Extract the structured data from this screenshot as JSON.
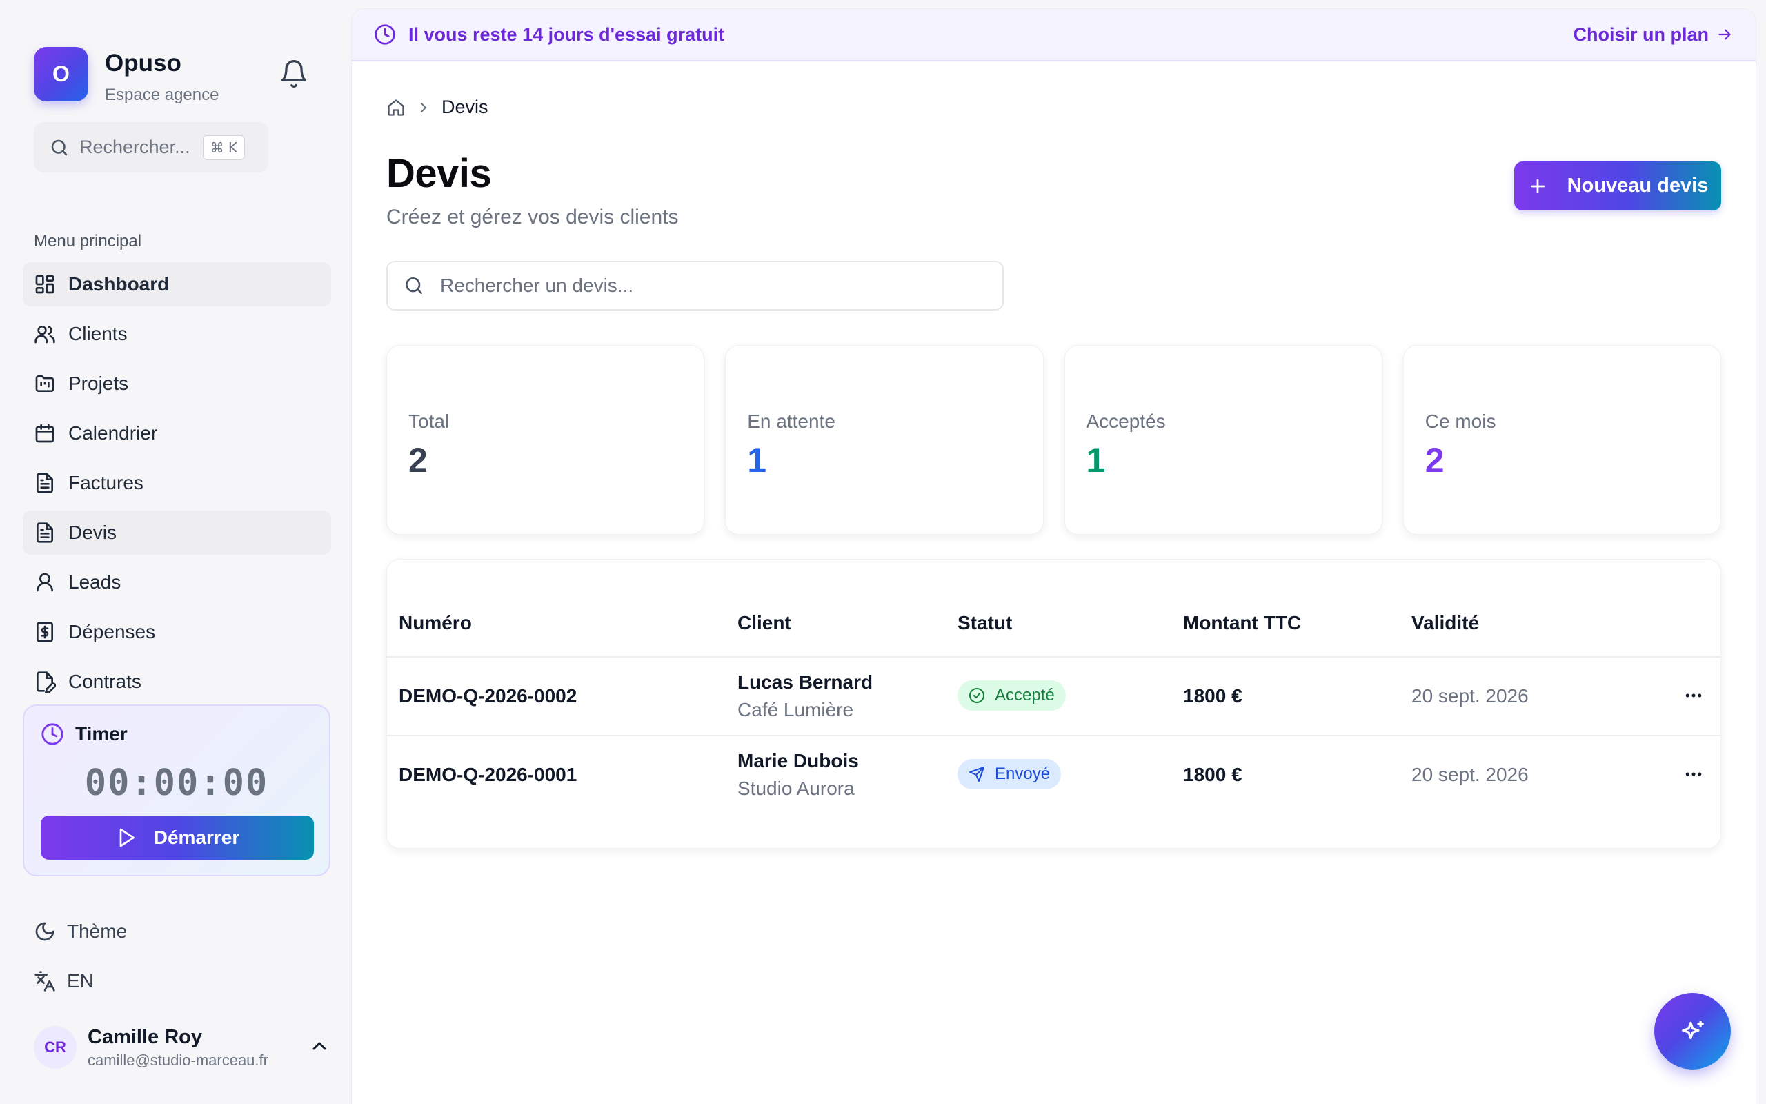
{
  "brand": {
    "logo_letter": "O",
    "name": "Opuso",
    "subtitle": "Espace agence"
  },
  "sidebar": {
    "search": {
      "placeholder": "Rechercher...",
      "shortcut": "⌘ K"
    },
    "menu_label": "Menu principal",
    "items": [
      {
        "label": "Dashboard",
        "icon": "dashboard-icon",
        "active": true
      },
      {
        "label": "Clients",
        "icon": "users-icon"
      },
      {
        "label": "Projets",
        "icon": "folder-kanban-icon"
      },
      {
        "label": "Calendrier",
        "icon": "calendar-icon"
      },
      {
        "label": "Factures",
        "icon": "file-text-icon"
      },
      {
        "label": "Devis",
        "icon": "file-text-icon",
        "active": true
      },
      {
        "label": "Leads",
        "icon": "user-icon"
      },
      {
        "label": "Dépenses",
        "icon": "receipt-icon"
      },
      {
        "label": "Contrats",
        "icon": "file-signature-icon"
      }
    ],
    "timer": {
      "title": "Timer",
      "time": "00:00:00",
      "start_label": "Démarrer"
    },
    "theme_label": "Thème",
    "language_label": "EN",
    "user": {
      "initials": "CR",
      "name": "Camille Roy",
      "email": "camille@studio-marceau.fr"
    }
  },
  "banner": {
    "text": "Il vous reste 14 jours d'essai gratuit",
    "link": "Choisir un plan"
  },
  "breadcrumb": {
    "current": "Devis"
  },
  "page": {
    "title": "Devis",
    "subtitle": "Créez et gérez vos devis clients",
    "new_button": "Nouveau devis",
    "search_placeholder": "Rechercher un devis..."
  },
  "stats": [
    {
      "label": "Total",
      "value": "2",
      "color": "#374151"
    },
    {
      "label": "En attente",
      "value": "1",
      "color": "#2563eb"
    },
    {
      "label": "Acceptés",
      "value": "1",
      "color": "#059669"
    },
    {
      "label": "Ce mois",
      "value": "2",
      "color": "#7c3aed"
    }
  ],
  "table": {
    "headers": [
      "Numéro",
      "Client",
      "Statut",
      "Montant TTC",
      "Validité"
    ],
    "rows": [
      {
        "number": "DEMO-Q-2026-0002",
        "client": "Lucas Bernard",
        "company": "Café Lumière",
        "status": "Accepté",
        "status_type": "accepted",
        "amount": "1800 €",
        "validity": "20 sept. 2026"
      },
      {
        "number": "DEMO-Q-2026-0001",
        "client": "Marie Dubois",
        "company": "Studio Aurora",
        "status": "Envoyé",
        "status_type": "sent",
        "amount": "1800 €",
        "validity": "20 sept. 2026"
      }
    ]
  },
  "colors": {
    "accent": "#7c3aed",
    "accent_blue": "#4f46e5",
    "teal": "#0891b2"
  }
}
